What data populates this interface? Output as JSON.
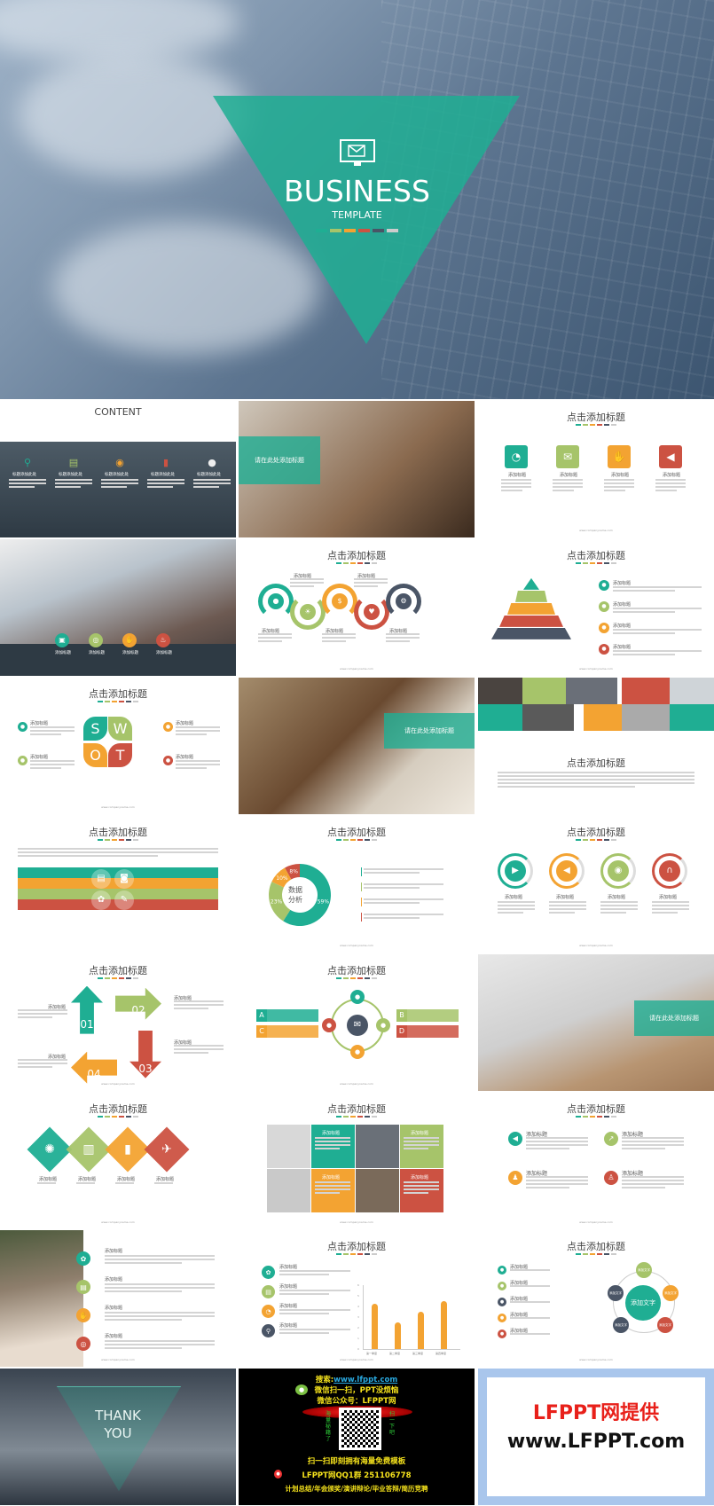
{
  "colors": {
    "teal": "#1fae93",
    "green": "#a6c46a",
    "orange": "#f3a332",
    "red": "#cc5242",
    "slate": "#4a5566",
    "gray": "#cfcfcf"
  },
  "footer_url": "www.companyname.com",
  "slide_title": "点击添加标题",
  "item_title": "添加标题",
  "cover": {
    "title": "BUSINESS",
    "subtitle": "TEMPLATE",
    "icon": "monitor-mail-icon"
  },
  "content": {
    "title": "CONTENT",
    "items": [
      "标题添加此处",
      "标题添加此处",
      "标题添加此处",
      "标题添加此处",
      "标题添加此处"
    ],
    "icons": [
      "search-icon",
      "browser-icon",
      "person-icon",
      "bar-chart-icon",
      "head-icon"
    ]
  },
  "section_title": "请在此处添加标题",
  "swot": [
    "S",
    "W",
    "O",
    "T"
  ],
  "donut": {
    "center_l1": "数据",
    "center_l2": "分析",
    "labels": [
      "59%",
      "23%",
      "10%",
      "8%"
    ]
  },
  "arrows": [
    "01",
    "02",
    "03",
    "04"
  ],
  "abcd": [
    "A",
    "B",
    "C",
    "D"
  ],
  "circle_text": "添加文字",
  "thank_you": {
    "line1": "THANK",
    "line2": "YOU"
  },
  "ad": {
    "search_label": "搜索:",
    "search_url": "www.lfppt.com",
    "line2": "微信扫一扫，PPT没烦恼",
    "line3": "微信公众号：LFPPT网",
    "left_vert": "海量秘籍了",
    "right_vert": "扫一下吧",
    "line4": "扫一扫即刻拥有海量免费模板",
    "line5": "LFPPT网QQ1群 251106778",
    "line6": "计划总结/年会颁奖/演讲辩论/毕业答辩/简历竞聘"
  },
  "brand": {
    "line1": "LFPPT网提供",
    "line2": "www.LFPPT.com"
  },
  "chart_data": [
    {
      "type": "pie",
      "values": [
        59,
        23,
        10,
        8
      ],
      "labels": [
        "59%",
        "23%",
        "10%",
        "8%"
      ],
      "colors": [
        "#1fae93",
        "#a6c46a",
        "#f3a332",
        "#cc5242"
      ]
    },
    {
      "type": "bar",
      "categories": [
        "第一季度",
        "第二季度",
        "第三季度",
        "第四季度"
      ],
      "values": [
        4.3,
        2.5,
        3.5,
        4.5
      ],
      "ylim": [
        0,
        6
      ],
      "yticks": [
        0,
        1,
        2,
        3,
        4,
        5,
        6
      ],
      "color": "#f3a332"
    }
  ]
}
